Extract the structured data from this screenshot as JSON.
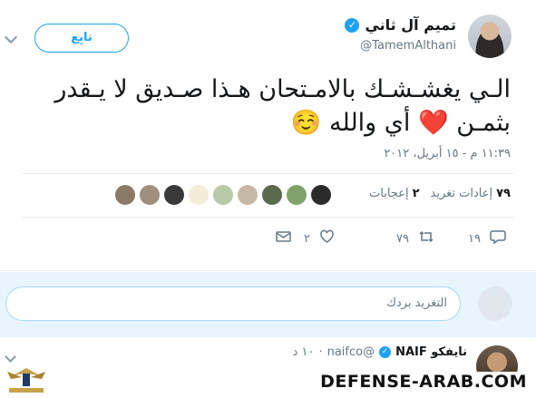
{
  "tweet": {
    "name": "تميم آل ثاني",
    "handle": "@TamemAlthani",
    "follow_label": "تابِع",
    "text_line1": "الـي يغشـشـك بالامـتحان هـذا صـديق لا يـقدر",
    "text_line2_prefix": "بثمـن",
    "text_line2_suffix": "أي والله",
    "heart_emoji": "❤️",
    "smile_emoji": "☺️",
    "time": "١١:٣٩ م - ١٥ أبريل، ٢٠١٢"
  },
  "stats": {
    "retweets_count": "٧٩",
    "retweets_label": "إعادات تغريد",
    "likes_count": "٢",
    "likes_label": "إعجابات"
  },
  "actions": {
    "reply_count": "١٩",
    "retweet_count": "٧٩",
    "like_count": "٢"
  },
  "reply_box": {
    "placeholder": "التغريد بردك"
  },
  "reply": {
    "name": "نايفكو NAIF",
    "handle": "@naifco",
    "time": "١٠ د"
  },
  "watermark": {
    "text": "DEFENSE-ARAB.COM"
  },
  "colors": {
    "accent": "#1da1f2",
    "heart": "#e0245e",
    "muted": "#657786"
  }
}
